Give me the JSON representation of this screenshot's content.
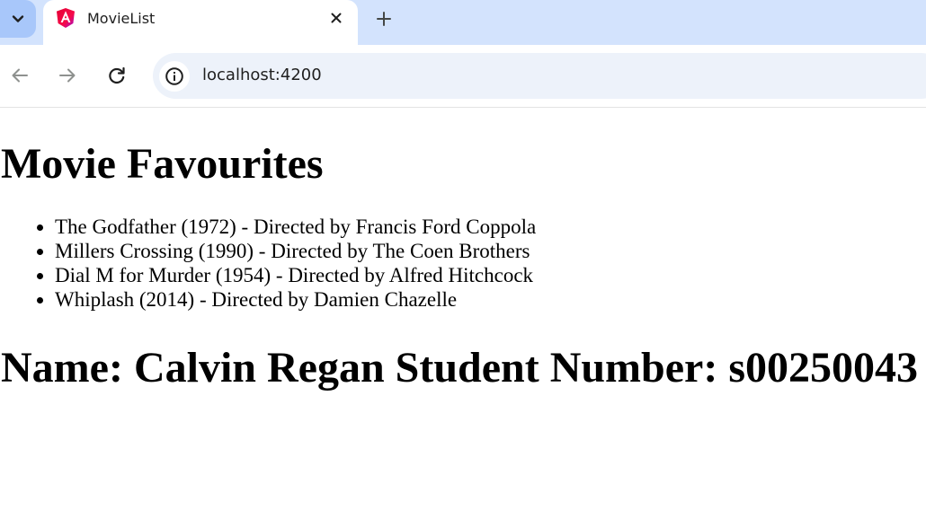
{
  "browser": {
    "tab": {
      "title": "MovieList"
    },
    "address_bar": {
      "url": "localhost:4200"
    }
  },
  "page": {
    "title": "Movie Favourites",
    "movies": [
      "The Godfather (1972) - Directed by Francis Ford Coppola",
      "Millers Crossing (1990) - Directed by The Coen Brothers",
      "Dial M for Murder (1954) - Directed by Alfred Hitchcock",
      "Whiplash (2014) - Directed by Damien Chazelle"
    ],
    "student_info": "Name: Calvin Regan Student Number: s00250043"
  },
  "icons": {
    "tab_search": "chevron-down-icon",
    "favicon": "angular-logo-icon",
    "tab_close": "close-icon",
    "new_tab": "plus-icon",
    "back": "arrow-left-icon",
    "forward": "arrow-right-icon",
    "reload": "reload-icon",
    "site_info": "info-icon"
  },
  "colors": {
    "tabstrip_bg": "#d3e3fd",
    "omnibox_bg": "#edf2fa",
    "angular_red": "#dd0031"
  }
}
